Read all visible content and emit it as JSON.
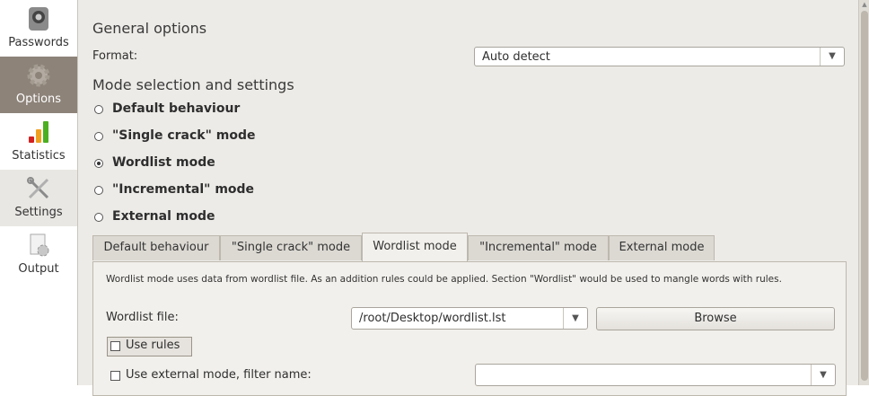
{
  "sidebar": {
    "items": [
      {
        "label": "Passwords",
        "icon": "lock-icon"
      },
      {
        "label": "Options",
        "icon": "gear-icon"
      },
      {
        "label": "Statistics",
        "icon": "bar-chart-icon"
      },
      {
        "label": "Settings",
        "icon": "tools-icon"
      },
      {
        "label": "Output",
        "icon": "document-gear-icon"
      }
    ],
    "active": "Options"
  },
  "general": {
    "title": "General options",
    "format_label": "Format:",
    "format_value": "Auto detect"
  },
  "mode": {
    "title": "Mode selection and settings",
    "options": [
      {
        "label": "Default behaviour",
        "checked": false
      },
      {
        "label": "\"Single crack\" mode",
        "checked": false
      },
      {
        "label": "Wordlist mode",
        "checked": true
      },
      {
        "label": "\"Incremental\" mode",
        "checked": false
      },
      {
        "label": "External mode",
        "checked": false
      }
    ]
  },
  "tabs": [
    {
      "label": "Default behaviour",
      "active": false
    },
    {
      "label": "\"Single crack\" mode",
      "active": false
    },
    {
      "label": "Wordlist mode",
      "active": true
    },
    {
      "label": "\"Incremental\" mode",
      "active": false
    },
    {
      "label": "External mode",
      "active": false
    }
  ],
  "wordlist": {
    "description": "Wordlist mode uses data from wordlist file. As an addition rules could be applied. Section \"Wordlist\" would be used to mangle words with rules.",
    "file_label": "Wordlist file:",
    "file_value": "/root/Desktop/wordlist.lst",
    "browse_label": "Browse",
    "use_rules_label": "Use rules",
    "use_rules_checked": false,
    "external_filter_label": "Use external mode, filter name:",
    "external_filter_checked": false,
    "external_filter_value": ""
  },
  "colors": {
    "sidebar_active": "#8d8379",
    "main_bg": "#edebe7"
  }
}
